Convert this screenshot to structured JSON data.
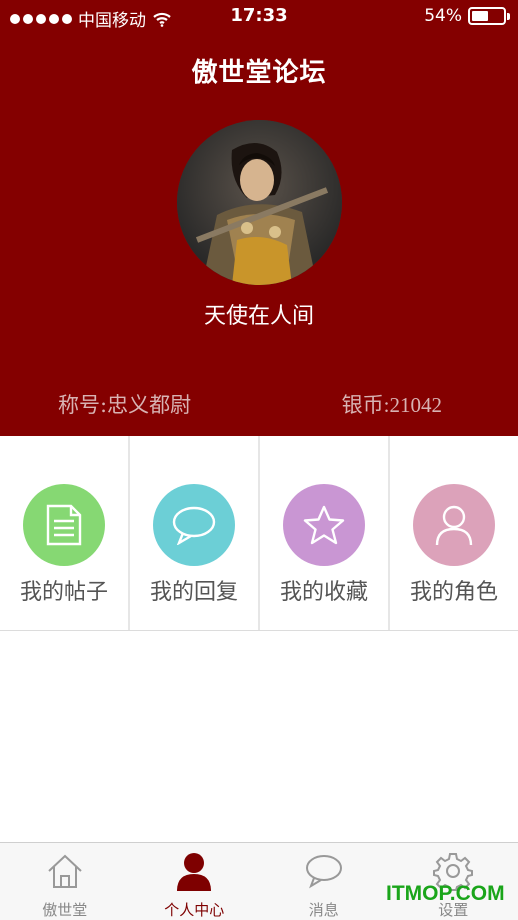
{
  "status_bar": {
    "carrier": "中国移动",
    "time": "17:33",
    "battery": "54%",
    "battery_level": 0.54
  },
  "header": {
    "title": "傲世堂论坛"
  },
  "profile": {
    "username": "天使在人间",
    "rank": "称号:忠义都尉",
    "coins": "银币:21042"
  },
  "menu": [
    {
      "label": "我的帖子",
      "icon": "document-icon",
      "color": "#86d873"
    },
    {
      "label": "我的回复",
      "icon": "speech-bubble-icon",
      "color": "#6ccfd6"
    },
    {
      "label": "我的收藏",
      "icon": "star-icon",
      "color": "#c996d3"
    },
    {
      "label": "我的角色",
      "icon": "user-icon",
      "color": "#dca2ba"
    }
  ],
  "tabbar": [
    {
      "label": "傲世堂",
      "icon": "home-icon",
      "active": false
    },
    {
      "label": "个人中心",
      "icon": "person-icon",
      "active": true
    },
    {
      "label": "消息",
      "icon": "message-icon",
      "active": false
    },
    {
      "label": "设置",
      "icon": "gear-icon",
      "active": false
    }
  ],
  "watermark": "ITMOP.COM",
  "colors": {
    "header_bg": "#840000",
    "active_tab": "#7e0000"
  }
}
